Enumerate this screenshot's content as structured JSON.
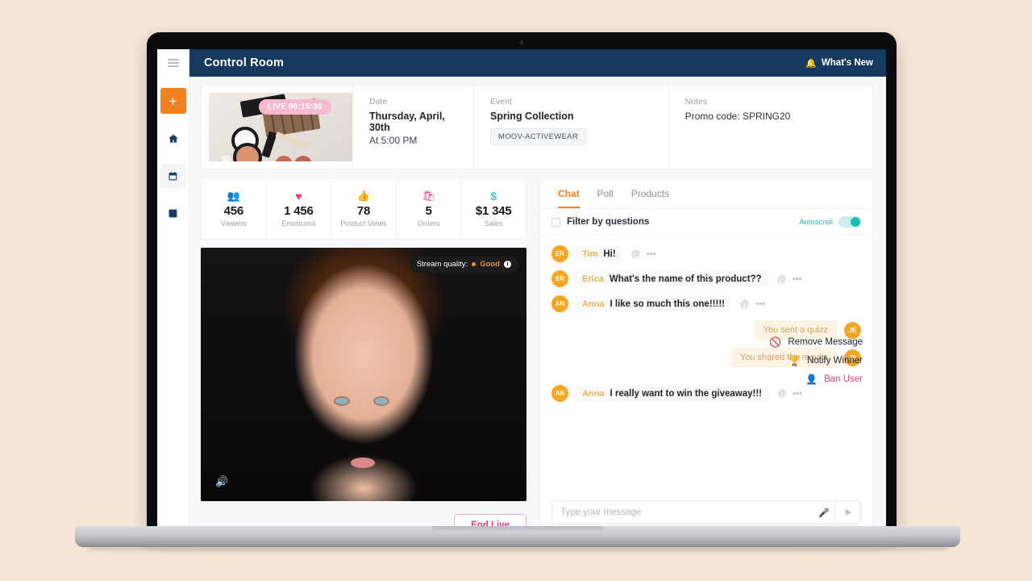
{
  "device": {
    "label": "MacBook Pro"
  },
  "topbar": {
    "title": "Control Room",
    "whats_new": "What's New",
    "bell_icon": "bell-icon",
    "bg": "#163a5f"
  },
  "rail": {
    "menu_icon": "hamburger-icon",
    "add_label": "+",
    "items": [
      {
        "icon": "home-icon",
        "glyph": "⌂",
        "active": false
      },
      {
        "icon": "calendar-icon",
        "glyph": "Ὄ5",
        "active": true
      },
      {
        "icon": "analytics-icon",
        "glyph": "ὌA",
        "active": false
      }
    ]
  },
  "info": {
    "live_badge": "LIVE 00:15:30",
    "date": {
      "label": "Date",
      "value": "Thursday, April, 30th",
      "time": "At 5:00 PM"
    },
    "event": {
      "label": "Event",
      "value": "Spring Collection",
      "chip": "MOOV-ACTIVEWEAR"
    },
    "notes": {
      "label": "Notes",
      "value": "Promo code: SPRING20"
    }
  },
  "stats": [
    {
      "icon": "viewers-icon",
      "glyph": "👥",
      "color": "#3fc8c4",
      "value": "456",
      "label": "Viewers"
    },
    {
      "icon": "heart-icon",
      "glyph": "♥",
      "color": "#f5376f",
      "value": "1 456",
      "label": "Emoticons"
    },
    {
      "icon": "thumbs-up-icon",
      "glyph": "👍",
      "color": "#f7b733",
      "value": "78",
      "label": "Product Views"
    },
    {
      "icon": "orders-icon",
      "glyph": "🛍",
      "color": "#f5376f",
      "value": "5",
      "label": "Orders"
    },
    {
      "icon": "dollar-icon",
      "glyph": "$",
      "color": "#3fc8c4",
      "value": "$1 345",
      "label": "Sales"
    }
  ],
  "video": {
    "stream_quality_label": "Stream quality:",
    "stream_quality_value": "Good",
    "info_icon": "info-icon",
    "speaker_icon": "speaker-icon",
    "end_live": "End Live"
  },
  "chat": {
    "tabs": [
      {
        "label": "Chat",
        "active": true
      },
      {
        "label": "Poll",
        "active": false
      },
      {
        "label": "Products",
        "active": false
      }
    ],
    "filter_label": "Filter by questions",
    "autoscroll_label": "Autoscroll",
    "messages": [
      {
        "avatar": "ER",
        "name": "Tim",
        "text": "Hi!",
        "side": "in",
        "at": "@",
        "more": "•••"
      },
      {
        "avatar": "ER",
        "name": "Erica",
        "text": "What's the name of this product??",
        "side": "in",
        "at": "@",
        "more": "•••"
      },
      {
        "avatar": "AN",
        "name": "Anna",
        "text": "I like so much this one!!!!!",
        "side": "in",
        "at": "@",
        "more": "•••"
      },
      {
        "avatar": "JE",
        "text": "You sent a quizz",
        "side": "out"
      },
      {
        "avatar": "JE",
        "text": "You shared the results",
        "side": "out"
      },
      {
        "avatar": "AN",
        "name": "Anna",
        "text": "I really want to win the giveaway!!!",
        "side": "in",
        "at": "@",
        "more": "•••"
      }
    ],
    "context_menu": [
      {
        "icon": "block-icon",
        "glyph": "⦸",
        "label": "Remove Message",
        "danger": false
      },
      {
        "icon": "trophy-icon",
        "glyph": "🏆",
        "label": "Notify Winner",
        "danger": false
      },
      {
        "icon": "ban-user-icon",
        "glyph": "👤",
        "label": "Ban User",
        "danger": true
      }
    ],
    "composer": {
      "placeholder": "Type your message",
      "mic_icon": "mic-icon",
      "send_icon": "send-icon"
    }
  },
  "colors": {
    "accent_orange": "#f28021",
    "navy": "#163a5f",
    "teal": "#16c0b6",
    "pink": "#ec3f75",
    "page_bg": "#f6e6d6"
  }
}
